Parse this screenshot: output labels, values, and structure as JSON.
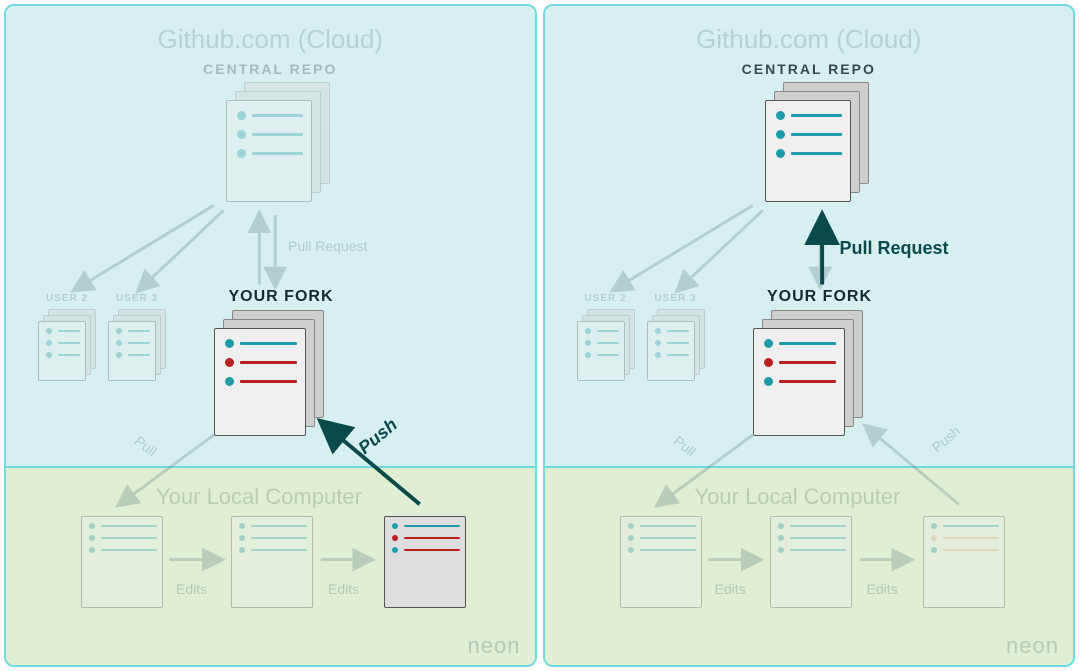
{
  "panels": {
    "left": {
      "cloud_title": "Github.com (Cloud)",
      "central_repo_label": "CENTRAL REPO",
      "user2_label": "USER 2",
      "user3_label": "USER 3",
      "your_fork_label": "YOUR FORK",
      "pull_request_label": "Pull Request",
      "pull_label": "Pull",
      "push_label": "Push",
      "local_title": "Your Local Computer",
      "edits_label_1": "Edits",
      "edits_label_2": "Edits",
      "watermark": "neon",
      "emphasis": "push"
    },
    "right": {
      "cloud_title": "Github.com (Cloud)",
      "central_repo_label": "CENTRAL REPO",
      "user2_label": "USER 2",
      "user3_label": "USER 3",
      "your_fork_label": "YOUR FORK",
      "pull_request_label": "Pull Request",
      "pull_label": "Pull",
      "push_label": "Push",
      "local_title": "Your Local Computer",
      "edits_label_1": "Edits",
      "edits_label_2": "Edits",
      "watermark": "neon",
      "emphasis": "pull_request"
    }
  },
  "colors": {
    "cloud_bg": "#d7efef",
    "local_bg": "#e0eed3",
    "border": "#6edbe0",
    "teal": "#1e9aa8",
    "red": "#b92020",
    "dark_teal": "#0a4a4a"
  }
}
